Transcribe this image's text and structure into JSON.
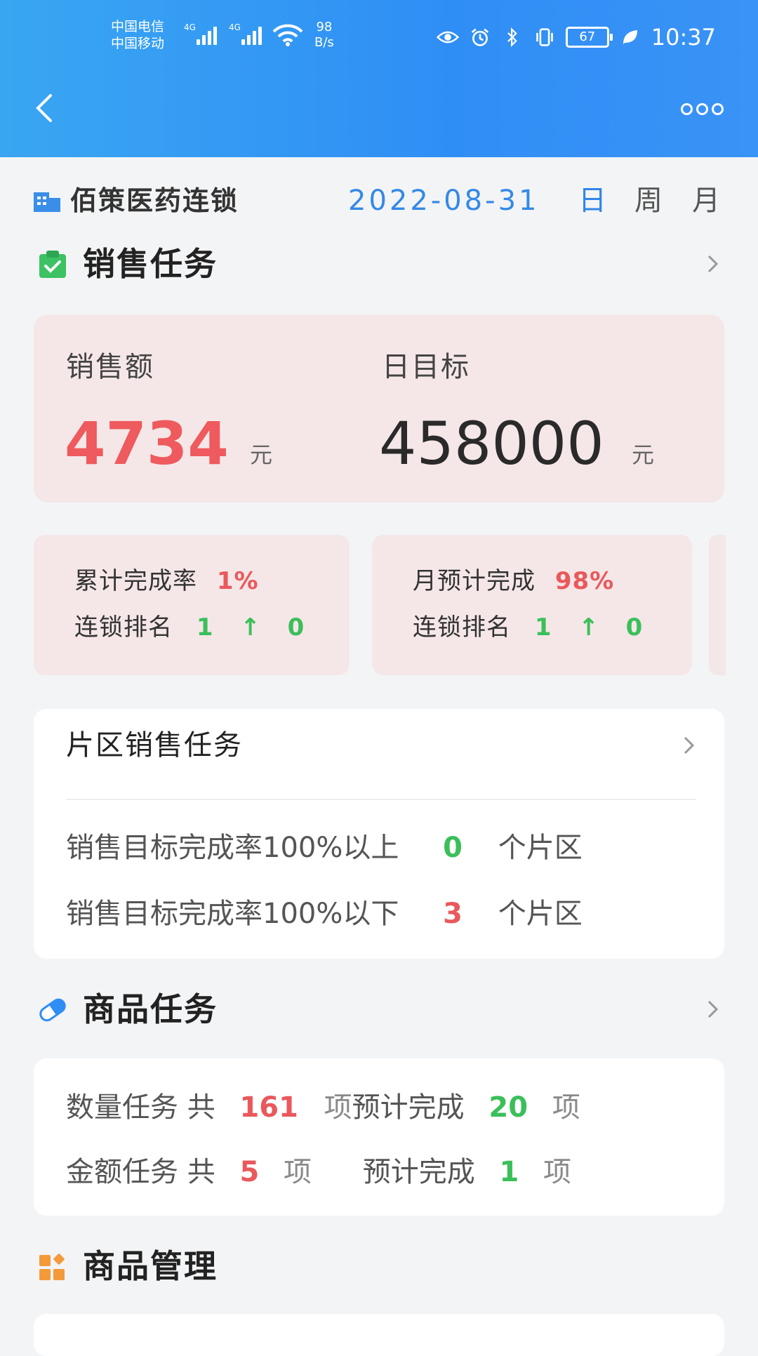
{
  "status_bar": {
    "carrier_1": "中国电信",
    "carrier_2": "中国移动",
    "network_1": "4G",
    "network_2": "4G",
    "net_speed_value": "98",
    "net_speed_unit": "B/s",
    "battery": "67",
    "time": "10:37"
  },
  "header": {
    "back_icon": "chevron-left-icon",
    "more_icon": "more-dots-icon"
  },
  "filter": {
    "company": "佰策医药连锁",
    "date": "2022-08-31",
    "periods": [
      "日",
      "周",
      "月"
    ],
    "active_period": "日"
  },
  "sales_task": {
    "title": "销售任务",
    "sales_label": "销售额",
    "sales_value": "4734",
    "sales_unit": "元",
    "target_label": "日目标",
    "target_value": "458000",
    "target_unit": "元",
    "cards": [
      {
        "rate_label": "累计完成率",
        "rate_value": "1%",
        "rank_label": "连锁排名",
        "rank_value": "1",
        "rank_arrow": "↑",
        "rank_change": "0"
      },
      {
        "rate_label": "月预计完成",
        "rate_value": "98%",
        "rank_label": "连锁排名",
        "rank_value": "1",
        "rank_arrow": "↑",
        "rank_change": "0"
      }
    ]
  },
  "area_task": {
    "title": "片区销售任务",
    "rows": [
      {
        "label": "销售目标完成率100%以上",
        "count": "0",
        "unit": "个片区"
      },
      {
        "label": "销售目标完成率100%以下",
        "count": "3",
        "unit": "个片区"
      }
    ]
  },
  "product_task": {
    "title": "商品任务",
    "rows": [
      {
        "label": "数量任务 共",
        "total": "161",
        "unit1": "项",
        "expect_label": "预计完成",
        "expect": "20",
        "unit2": "项"
      },
      {
        "label": "金额任务 共",
        "total": "5",
        "unit1": "项",
        "expect_label": "预计完成",
        "expect": "1",
        "unit2": "项"
      }
    ]
  },
  "product_mgmt": {
    "title": "商品管理"
  },
  "colors": {
    "header_blue": "#2f8ef5",
    "accent_red": "#e9595c",
    "accent_green": "#3bbf5a",
    "date_blue": "#3489e6"
  }
}
